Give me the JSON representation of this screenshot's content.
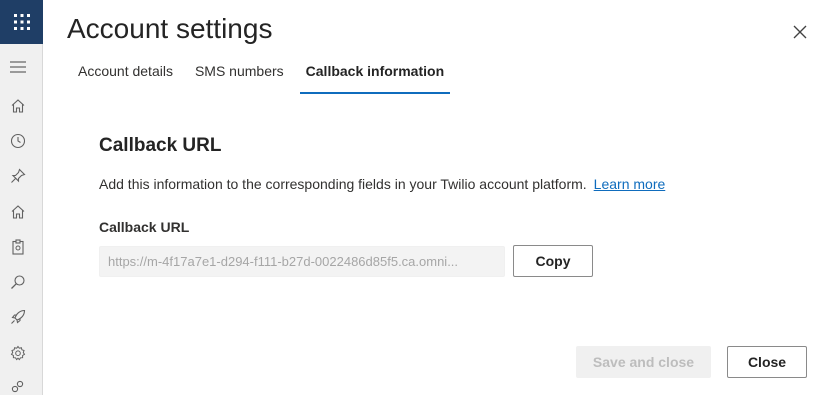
{
  "dialog": {
    "title": "Account settings",
    "close_icon": "close-icon"
  },
  "tabs": [
    {
      "label": "Account details",
      "active": false
    },
    {
      "label": "SMS numbers",
      "active": false
    },
    {
      "label": "Callback information",
      "active": true
    }
  ],
  "section": {
    "title": "Callback URL",
    "description": "Add this information to the corresponding fields in your Twilio account platform.",
    "learn_more": "Learn more",
    "field_label": "Callback URL",
    "field_value": "https://m-4f17a7e1-d294-f111-b27d-0022486d85f5.ca.omni...",
    "copy_label": "Copy"
  },
  "footer": {
    "save_label": "Save and close",
    "close_label": "Close"
  },
  "rail": {
    "icons": [
      "waffle-icon",
      "hamburger-icon",
      "home-icon",
      "recent-icon",
      "pin-icon",
      "home-icon",
      "clipboard-icon",
      "search-icon",
      "rocket-icon",
      "settings-icon",
      "people-icon"
    ]
  },
  "colors": {
    "accent": "#0f6cbd",
    "waffle_bg": "#1f3e66",
    "rail_bg": "#f0f0f0"
  }
}
